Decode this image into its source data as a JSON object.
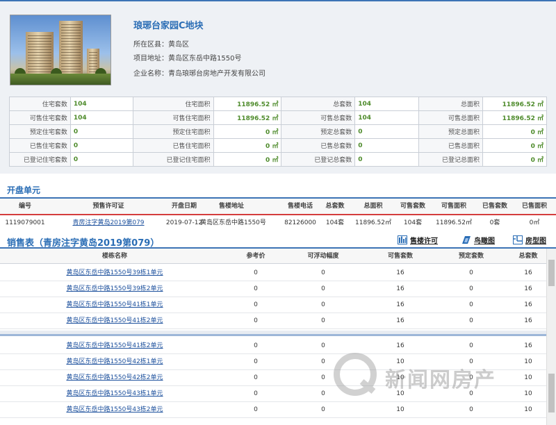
{
  "project": {
    "title": "琅琊台家园C地块",
    "district": "所在区县：黄岛区",
    "address": "项目地址：黄岛区东岳中路1550号",
    "company": "企业名称：青岛琅琊台房地产开发有限公司"
  },
  "stats": [
    [
      {
        "l": "住宅套数",
        "v": "104"
      },
      {
        "l": "住宅面积",
        "v": "11896.52 ㎡"
      },
      {
        "l": "总套数",
        "v": "104"
      },
      {
        "l": "总面积",
        "v": "11896.52 ㎡"
      }
    ],
    [
      {
        "l": "可售住宅套数",
        "v": "104"
      },
      {
        "l": "可售住宅面积",
        "v": "11896.52 ㎡"
      },
      {
        "l": "可售总套数",
        "v": "104"
      },
      {
        "l": "可售总面积",
        "v": "11896.52 ㎡"
      }
    ],
    [
      {
        "l": "预定住宅套数",
        "v": "0"
      },
      {
        "l": "预定住宅面积",
        "v": "0 ㎡"
      },
      {
        "l": "预定总套数",
        "v": "0"
      },
      {
        "l": "预定总面积",
        "v": "0 ㎡"
      }
    ],
    [
      {
        "l": "已售住宅套数",
        "v": "0"
      },
      {
        "l": "已售住宅面积",
        "v": "0 ㎡"
      },
      {
        "l": "已售总套数",
        "v": "0"
      },
      {
        "l": "已售总面积",
        "v": "0 ㎡"
      }
    ],
    [
      {
        "l": "已登记住宅套数",
        "v": "0"
      },
      {
        "l": "已登记住宅面积",
        "v": "0 ㎡"
      },
      {
        "l": "已登记总套数",
        "v": "0"
      },
      {
        "l": "已登记总面积",
        "v": "0 ㎡"
      }
    ]
  ],
  "opening": {
    "title": "开盘单元",
    "headers": [
      "编号",
      "预售许可证",
      "开盘日期",
      "售楼地址",
      "售楼电话",
      "总套数",
      "总面积",
      "可售套数",
      "可售面积",
      "已售套数",
      "已售面积"
    ],
    "row": [
      "1119079001",
      "青房注字黄岛2019第079",
      "2019-07-12",
      "黄岛区东岳中路1550号",
      "82126000",
      "104套",
      "11896.52㎡",
      "104套",
      "11896.52㎡",
      "0套",
      "0㎡"
    ]
  },
  "sales": {
    "title": "销售表（青房注字黄岛2019第079）",
    "buttons": [
      "售楼许可",
      "鸟瞰图",
      "房型图"
    ],
    "headers": [
      "楼栋名称",
      "参考价",
      "可浮动幅度",
      "可售套数",
      "预定套数",
      "总套数"
    ],
    "rows": [
      [
        "黄岛区东岳中路1550号39栋1单元",
        "0",
        "0",
        "16",
        "0",
        "16"
      ],
      [
        "黄岛区东岳中路1550号39栋2单元",
        "0",
        "0",
        "16",
        "0",
        "16"
      ],
      [
        "黄岛区东岳中路1550号41栋1单元",
        "0",
        "0",
        "16",
        "0",
        "16"
      ],
      [
        "黄岛区东岳中路1550号41栋2单元",
        "0",
        "0",
        "16",
        "0",
        "16"
      ],
      [
        "黄岛区东岳中路1550号41栋2单元",
        "0",
        "0",
        "16",
        "0",
        "16"
      ],
      [
        "黄岛区东岳中路1550号42栋1单元",
        "0",
        "0",
        "10",
        "0",
        "10"
      ],
      [
        "黄岛区东岳中路1550号42栋2单元",
        "0",
        "0",
        "10",
        "0",
        "10"
      ],
      [
        "黄岛区东岳中路1550号43栋1单元",
        "0",
        "0",
        "10",
        "0",
        "10"
      ],
      [
        "黄岛区东岳中路1550号43栋2单元",
        "0",
        "0",
        "10",
        "0",
        "10"
      ]
    ]
  },
  "watermark": "新闻网房产",
  "colors": {
    "brand_blue": "#2a6db5",
    "accent_green": "#4e8b2b",
    "divider_red": "#d43c3c",
    "link_blue": "#1b4f9c"
  }
}
